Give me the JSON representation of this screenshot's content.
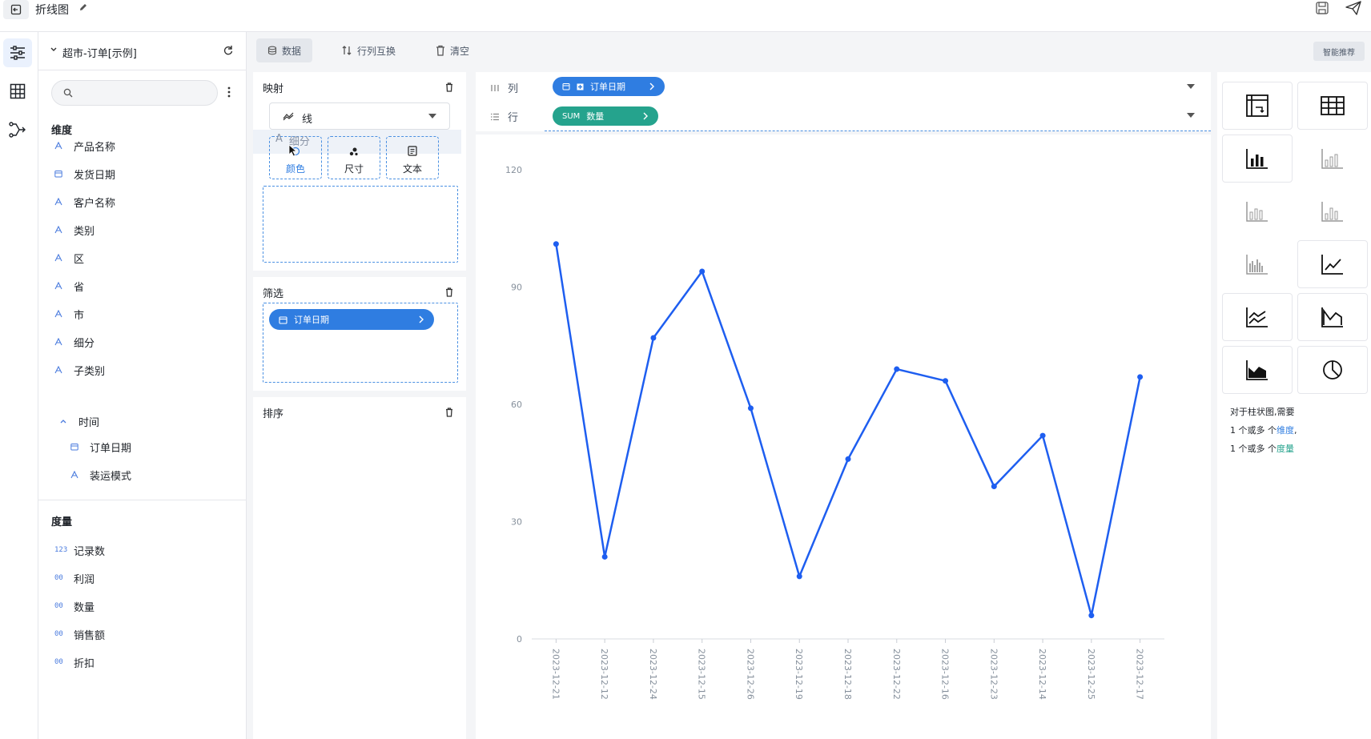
{
  "app": {
    "title": "折线图",
    "icons": {
      "back": "exit-icon",
      "edit": "pencil-icon",
      "save": "save-icon",
      "share": "send-icon"
    }
  },
  "rail": {
    "items": [
      "settings-sliders-icon",
      "table-grid-icon",
      "flow-branch-icon"
    ]
  },
  "fields_panel": {
    "datasource": "超市-订单[示例]",
    "search_placeholder": "",
    "dimensions_title": "维度",
    "dimensions": [
      {
        "label": "产品名称",
        "type": "text"
      },
      {
        "label": "发货日期",
        "type": "date"
      },
      {
        "label": "客户名称",
        "type": "text"
      },
      {
        "label": "类别",
        "type": "text"
      },
      {
        "label": "区",
        "type": "text"
      },
      {
        "label": "省",
        "type": "text"
      },
      {
        "label": "市",
        "type": "text"
      },
      {
        "label": "细分",
        "type": "text"
      },
      {
        "label": "子类别",
        "type": "text"
      }
    ],
    "time_group": {
      "label": "时间",
      "children": [
        {
          "label": "订单日期",
          "type": "date"
        },
        {
          "label": "装运模式",
          "type": "text"
        }
      ]
    },
    "measures_title": "度量",
    "measures": [
      {
        "label": "记录数",
        "badge": "123"
      },
      {
        "label": "利润",
        "badge": "00"
      },
      {
        "label": "数量",
        "badge": "00"
      },
      {
        "label": "销售额",
        "badge": "00"
      },
      {
        "label": "折扣",
        "badge": "00"
      }
    ]
  },
  "toolbar": {
    "data": "数据",
    "swap": "行列互换",
    "clear": "清空",
    "smart": "智能推荐"
  },
  "mapping": {
    "title": "映射",
    "mark_type": "线",
    "dragging_label": "细分",
    "channels": {
      "color": "颜色",
      "size": "尺寸",
      "text": "文本"
    },
    "filter_title": "筛选",
    "filter_pill": "订单日期",
    "sort_title": "排序"
  },
  "shelves": {
    "columns_label": "列",
    "columns_pill": "订单日期",
    "rows_label": "行",
    "rows_pill_agg": "SUM",
    "rows_pill_field": "数量"
  },
  "chart_data": {
    "type": "line",
    "title": "",
    "xlabel": "",
    "ylabel": "",
    "categories": [
      "2023-12-21",
      "2023-12-12",
      "2023-12-24",
      "2023-12-15",
      "2023-12-26",
      "2023-12-19",
      "2023-12-18",
      "2023-12-22",
      "2023-12-16",
      "2023-12-23",
      "2023-12-14",
      "2023-12-25",
      "2023-12-17"
    ],
    "series": [
      {
        "values": [
          101,
          21,
          77,
          94,
          59,
          16,
          46,
          69,
          66,
          39,
          52,
          6,
          67
        ]
      }
    ],
    "ylim": [
      0,
      120
    ],
    "yticks": [
      0,
      30,
      60,
      90,
      120
    ],
    "grid": false,
    "color": "#1e5ef0"
  },
  "gallery": {
    "hint_line1": "对于柱状图,需要",
    "hint_line2_prefix": "1 个或多 个",
    "hint_line2_link": "维度",
    "hint_line2_suffix": ",",
    "hint_line3_prefix": "1 个或多 个",
    "hint_line3_link": "度量"
  }
}
